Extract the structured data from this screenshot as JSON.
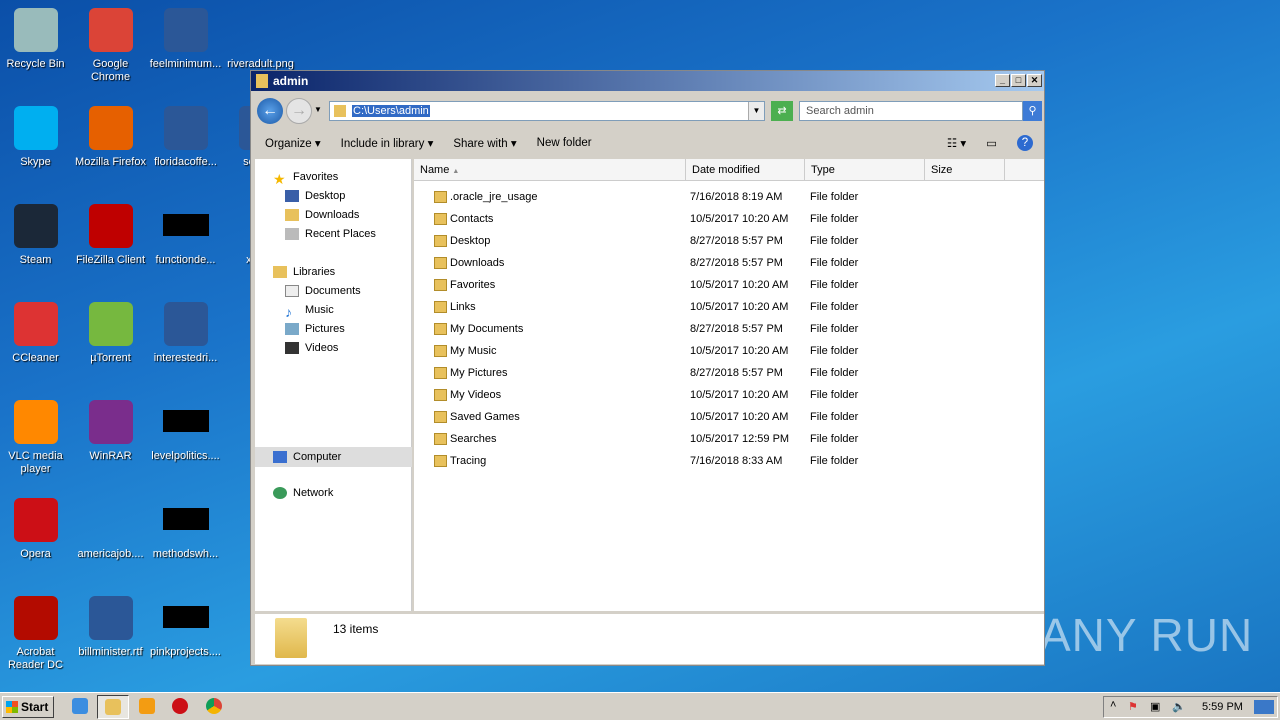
{
  "desktop": {
    "icons": [
      {
        "label": "Recycle Bin",
        "color": "#9bb"
      },
      {
        "label": "Google Chrome",
        "color": "#db4437"
      },
      {
        "label": "feelminimum...",
        "color": "#2b5797"
      },
      {
        "label": "riveradult.png",
        "color": "none"
      },
      {
        "label": "Skype",
        "color": "#00aff0"
      },
      {
        "label": "Mozilla Firefox",
        "color": "#e66000"
      },
      {
        "label": "floridacoffe...",
        "color": "#2b5797"
      },
      {
        "label": "scien...",
        "color": "#2b5797"
      },
      {
        "label": "Steam",
        "color": "#1b2838"
      },
      {
        "label": "FileZilla Client",
        "color": "#bf0000"
      },
      {
        "label": "functionde...",
        "color": "black"
      },
      {
        "label": "xxxr...",
        "color": "none"
      },
      {
        "label": "CCleaner",
        "color": "#d33"
      },
      {
        "label": "µTorrent",
        "color": "#76b83f"
      },
      {
        "label": "interestedri...",
        "color": "#2b5797"
      },
      {
        "label": "VLC media player",
        "color": "#f80"
      },
      {
        "label": "WinRAR",
        "color": "#7a2d8c"
      },
      {
        "label": "levelpolitics....",
        "color": "black"
      },
      {
        "label": "Opera",
        "color": "#cc0f16"
      },
      {
        "label": "americajob....",
        "color": "none"
      },
      {
        "label": "methodswh...",
        "color": "black"
      },
      {
        "label": "Acrobat Reader DC",
        "color": "#b30b00"
      },
      {
        "label": "billminister.rtf",
        "color": "#2b5797"
      },
      {
        "label": "pinkprojects....",
        "color": "black"
      }
    ]
  },
  "explorer": {
    "title": "admin",
    "address": "C:\\Users\\admin",
    "search_placeholder": "Search admin",
    "toolbar": {
      "organize": "Organize",
      "include": "Include in library",
      "share": "Share with",
      "new_folder": "New folder"
    },
    "nav": {
      "favorites": "Favorites",
      "fav_items": [
        "Desktop",
        "Downloads",
        "Recent Places"
      ],
      "libraries": "Libraries",
      "lib_items": [
        "Documents",
        "Music",
        "Pictures",
        "Videos"
      ],
      "computer": "Computer",
      "network": "Network"
    },
    "columns": [
      "Name",
      "Date modified",
      "Type",
      "Size"
    ],
    "files": [
      {
        "name": ".oracle_jre_usage",
        "date": "7/16/2018 8:19 AM",
        "type": "File folder"
      },
      {
        "name": "Contacts",
        "date": "10/5/2017 10:20 AM",
        "type": "File folder"
      },
      {
        "name": "Desktop",
        "date": "8/27/2018 5:57 PM",
        "type": "File folder"
      },
      {
        "name": "Downloads",
        "date": "8/27/2018 5:57 PM",
        "type": "File folder"
      },
      {
        "name": "Favorites",
        "date": "10/5/2017 10:20 AM",
        "type": "File folder"
      },
      {
        "name": "Links",
        "date": "10/5/2017 10:20 AM",
        "type": "File folder"
      },
      {
        "name": "My Documents",
        "date": "8/27/2018 5:57 PM",
        "type": "File folder"
      },
      {
        "name": "My Music",
        "date": "10/5/2017 10:20 AM",
        "type": "File folder"
      },
      {
        "name": "My Pictures",
        "date": "8/27/2018 5:57 PM",
        "type": "File folder"
      },
      {
        "name": "My Videos",
        "date": "10/5/2017 10:20 AM",
        "type": "File folder"
      },
      {
        "name": "Saved Games",
        "date": "10/5/2017 10:20 AM",
        "type": "File folder"
      },
      {
        "name": "Searches",
        "date": "10/5/2017 12:59 PM",
        "type": "File folder"
      },
      {
        "name": "Tracing",
        "date": "7/16/2018 8:33 AM",
        "type": "File folder"
      }
    ],
    "item_count": "13 items"
  },
  "taskbar": {
    "start": "Start",
    "clock": "5:59 PM",
    "apps": [
      "internet-explorer",
      "windows-explorer",
      "media-player",
      "opera",
      "chrome"
    ]
  },
  "watermark": "ANY RUN"
}
